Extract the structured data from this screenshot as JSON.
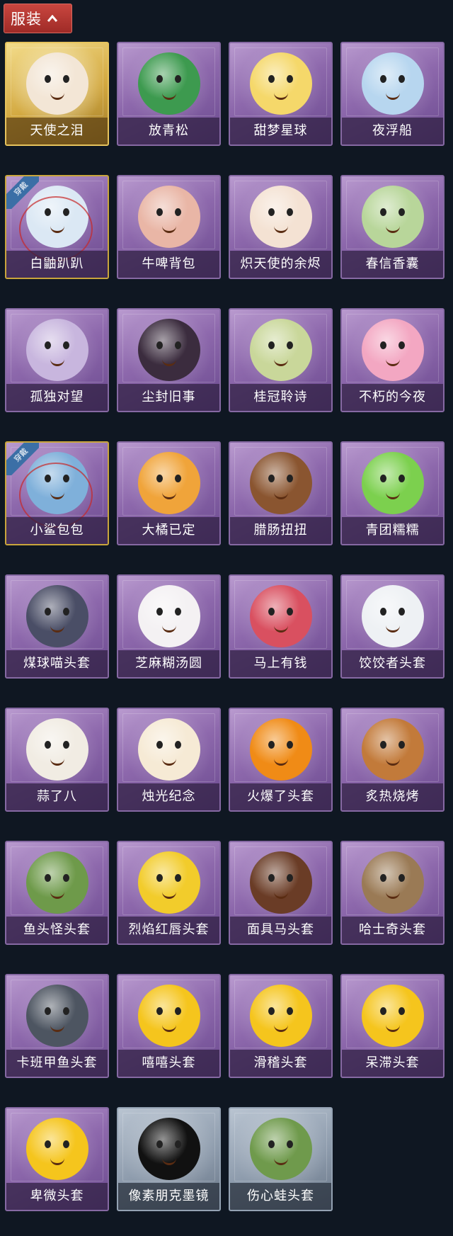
{
  "header": {
    "label": "服装"
  },
  "equipped_badge": "穿戴",
  "items": [
    {
      "name": "天使之泪",
      "icon": "angel-doll-icon",
      "theme": "gold",
      "art": "#f3e6d6",
      "equipped": false
    },
    {
      "name": "放青松",
      "icon": "bonsai-pine-icon",
      "theme": "purple",
      "art": "#3d9a4f",
      "equipped": false
    },
    {
      "name": "甜梦星球",
      "icon": "moon-fox-icon",
      "theme": "purple",
      "art": "#f5d86a",
      "equipped": false
    },
    {
      "name": "夜浮船",
      "icon": "jellyfish-icon",
      "theme": "purple",
      "art": "#b7d6ef",
      "equipped": false
    },
    {
      "name": "白鼬趴趴",
      "icon": "white-ferret-icon",
      "theme": "purple",
      "art": "#dbe8f4",
      "equipped": true
    },
    {
      "name": "牛啤背包",
      "icon": "beer-cow-icon",
      "theme": "purple",
      "art": "#e9b6a6",
      "equipped": false
    },
    {
      "name": "炽天使的余烬",
      "icon": "seraph-girl-icon",
      "theme": "purple",
      "art": "#f4e2d3",
      "equipped": false
    },
    {
      "name": "春信香囊",
      "icon": "sachet-icon",
      "theme": "purple",
      "art": "#b8d69a",
      "equipped": false
    },
    {
      "name": "孤独对望",
      "icon": "crystal-doll-icon",
      "theme": "purple",
      "art": "#c8b6de",
      "equipped": false
    },
    {
      "name": "尘封旧事",
      "icon": "dark-prince-icon",
      "theme": "purple",
      "art": "#3b2c3e",
      "equipped": false
    },
    {
      "name": "桂冠聆诗",
      "icon": "laurel-doll-icon",
      "theme": "purple",
      "art": "#c9d79a",
      "equipped": false
    },
    {
      "name": "不朽的今夜",
      "icon": "pink-cat-icon",
      "theme": "purple",
      "art": "#f3a7c2",
      "equipped": false
    },
    {
      "name": "小鲨包包",
      "icon": "shark-bag-icon",
      "theme": "purple",
      "art": "#7fb0da",
      "equipped": true
    },
    {
      "name": "大橘已定",
      "icon": "orange-slice-icon",
      "theme": "purple",
      "art": "#f0a43a",
      "equipped": false
    },
    {
      "name": "腊肠扭扭",
      "icon": "dachshund-icon",
      "theme": "purple",
      "art": "#8a5530",
      "equipped": false
    },
    {
      "name": "青团糯糯",
      "icon": "green-mochi-icon",
      "theme": "purple",
      "art": "#7cd04e",
      "equipped": false
    },
    {
      "name": "煤球喵头套",
      "icon": "black-cat-icon",
      "theme": "purple",
      "art": "#4a4e66",
      "equipped": false
    },
    {
      "name": "芝麻糊汤圆",
      "icon": "dumpling-icon",
      "theme": "purple",
      "art": "#f4f1f3",
      "equipped": false
    },
    {
      "name": "马上有钱",
      "icon": "red-horse-icon",
      "theme": "purple",
      "art": "#d95060",
      "equipped": false
    },
    {
      "name": "饺饺者头套",
      "icon": "cloud-dumpling-icon",
      "theme": "purple",
      "art": "#eef1f4",
      "equipped": false
    },
    {
      "name": "蒜了八",
      "icon": "garlic-icon",
      "theme": "purple",
      "art": "#f1ece3",
      "equipped": false
    },
    {
      "name": "烛光纪念",
      "icon": "candle-icon",
      "theme": "purple",
      "art": "#f6ead5",
      "equipped": false
    },
    {
      "name": "火爆了头套",
      "icon": "fire-icon",
      "theme": "purple",
      "art": "#f08b16",
      "equipped": false
    },
    {
      "name": "炙热烧烤",
      "icon": "bbq-meat-icon",
      "theme": "purple",
      "art": "#c27a3a",
      "equipped": false
    },
    {
      "name": "鱼头怪头套",
      "icon": "fish-head-icon",
      "theme": "purple",
      "art": "#6e9a4a",
      "equipped": false
    },
    {
      "name": "烈焰红唇头套",
      "icon": "yellow-mask-icon",
      "theme": "purple",
      "art": "#f2cc2b",
      "equipped": false
    },
    {
      "name": "面具马头套",
      "icon": "horse-mask-icon",
      "theme": "purple",
      "art": "#6a3c26",
      "equipped": false
    },
    {
      "name": "哈士奇头套",
      "icon": "husky-icon",
      "theme": "purple",
      "art": "#9a7a55",
      "equipped": false
    },
    {
      "name": "卡班甲鱼头套",
      "icon": "whale-icon",
      "theme": "purple",
      "art": "#4d5561",
      "equipped": false
    },
    {
      "name": "嘻嘻头套",
      "icon": "grin-emoji-icon",
      "theme": "purple",
      "art": "#f5c51d",
      "equipped": false
    },
    {
      "name": "滑稽头套",
      "icon": "smirk-emoji-icon",
      "theme": "purple",
      "art": "#f5c51d",
      "equipped": false
    },
    {
      "name": "呆滞头套",
      "icon": "stare-emoji-icon",
      "theme": "purple",
      "art": "#f5c51d",
      "equipped": false
    },
    {
      "name": "卑微头套",
      "icon": "humble-emoji-icon",
      "theme": "purple",
      "art": "#f5c51d",
      "equipped": false
    },
    {
      "name": "像素朋克墨镜",
      "icon": "pixel-sunglasses-icon",
      "theme": "gray",
      "art": "#111111",
      "equipped": false
    },
    {
      "name": "伤心蛙头套",
      "icon": "sad-frog-icon",
      "theme": "gray",
      "art": "#6f9a4c",
      "equipped": false
    }
  ]
}
